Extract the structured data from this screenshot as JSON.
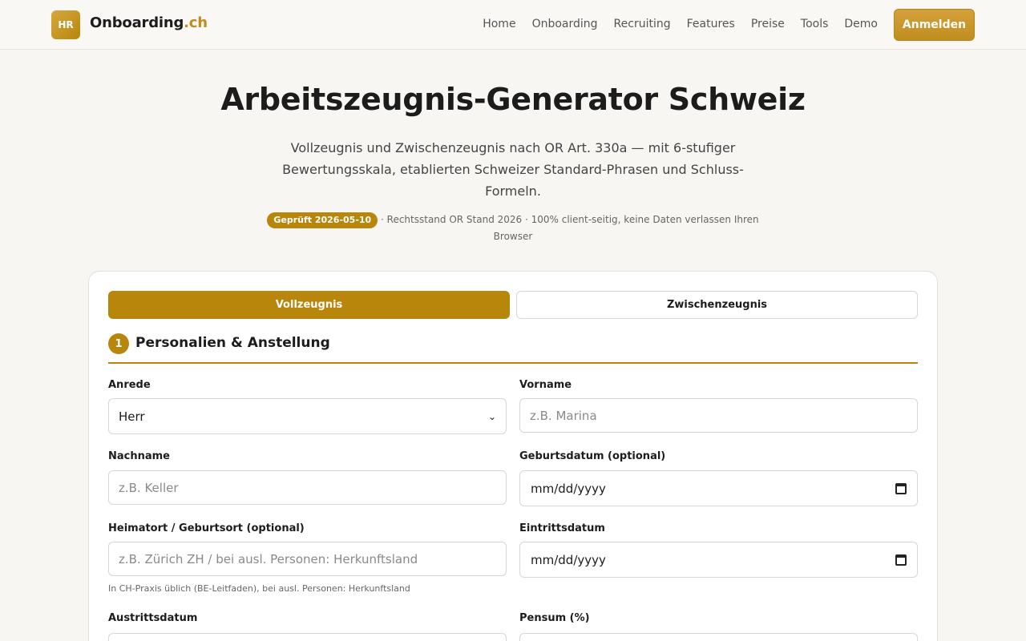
{
  "header": {
    "logo_badge": "HR",
    "logo_name": "Onboarding",
    "logo_tld": ".ch",
    "nav": [
      "Home",
      "Onboarding",
      "Recruiting",
      "Features",
      "Preise",
      "Tools",
      "Demo"
    ],
    "login_label": "Anmelden",
    "accent_color": "#b8860b"
  },
  "hero": {
    "title": "Arbeitszeugnis-Generator Schweiz",
    "subtitle": "Vollzeugnis und Zwischenzeugnis nach OR Art. 330a — mit 6-stufiger Bewertungsskala, etablierten Schweizer Standard-Phrasen und Schluss-Formeln.",
    "badge": "Geprüft 2026-05-10",
    "meta": " · Rechtsstand OR Stand 2026 · 100% client-seitig, keine Daten verlassen Ihren Browser"
  },
  "tabs": {
    "active": "Vollzeugnis",
    "inactive": "Zwischenzeugnis"
  },
  "section": {
    "number": "1",
    "title": "Personalien & Anstellung"
  },
  "form": {
    "anrede": {
      "label": "Anrede",
      "value": "Herr"
    },
    "vorname": {
      "label": "Vorname",
      "placeholder": "z.B. Marina"
    },
    "nachname": {
      "label": "Nachname",
      "placeholder": "z.B. Keller"
    },
    "geburtsdatum": {
      "label": "Geburtsdatum (optional)",
      "value": "mm/dd/yyyy"
    },
    "heimatort": {
      "label": "Heimatort / Geburtsort (optional)",
      "placeholder": "z.B. Zürich ZH / bei ausl. Personen: Herkunftsland",
      "hint": "In CH-Praxis üblich (BE-Leitfaden), bei ausl. Personen: Herkunftsland"
    },
    "eintritt": {
      "label": "Eintrittsdatum",
      "value": "mm/dd/yyyy"
    },
    "austritt": {
      "label": "Austrittsdatum"
    },
    "pensum": {
      "label": "Pensum (%)"
    }
  }
}
